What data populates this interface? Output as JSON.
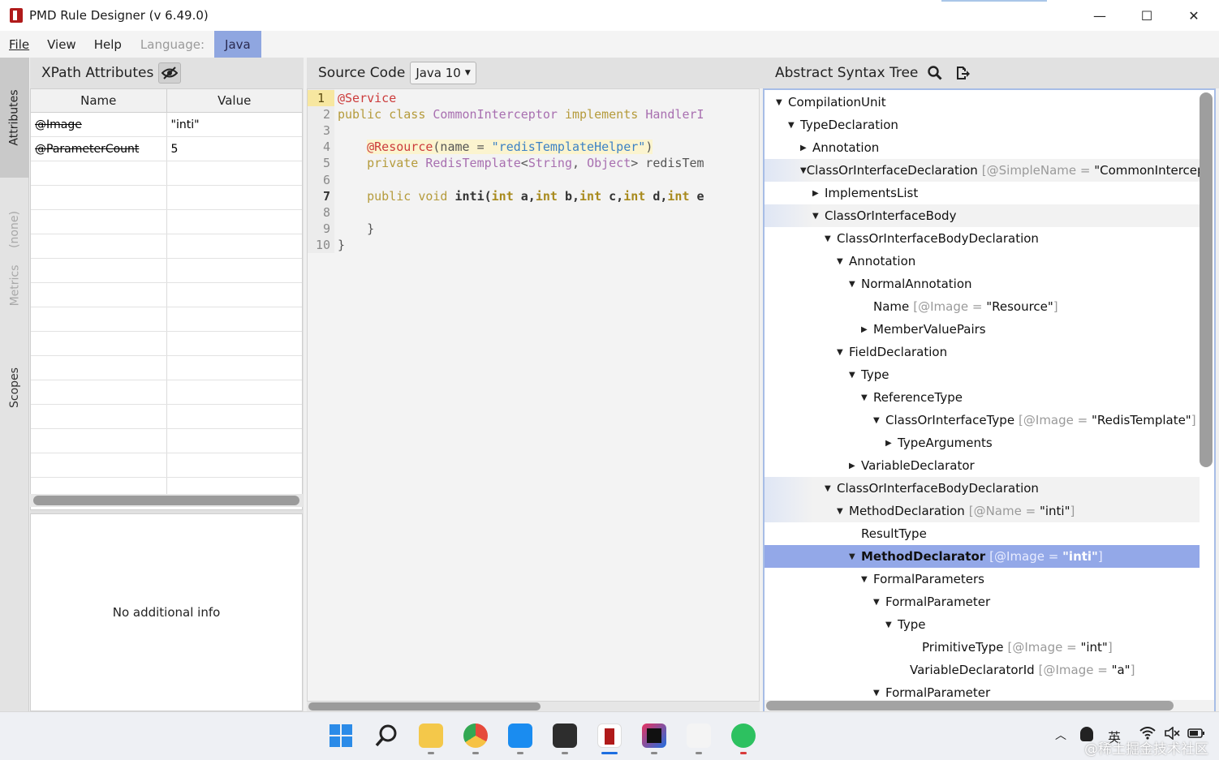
{
  "window": {
    "title": "PMD Rule Designer (v 6.49.0)",
    "minimize": "—",
    "maximize": "☐",
    "close": "✕"
  },
  "menu": {
    "file": "File",
    "view": "View",
    "help": "Help",
    "language_label": "Language:",
    "language_value": "Java"
  },
  "side_tabs": {
    "attributes": "Attributes",
    "none": "(none)",
    "metrics": "Metrics",
    "scopes": "Scopes"
  },
  "xpath_panel": {
    "title": "XPath Attributes",
    "col_name": "Name",
    "col_value": "Value",
    "rows": [
      {
        "name": "@Image",
        "value": "\"inti\""
      },
      {
        "name": "@ParameterCount",
        "value": "5"
      }
    ],
    "info": "No additional info"
  },
  "source_panel": {
    "title": "Source Code",
    "version": "Java 10",
    "current_line": 7,
    "lines": [
      {
        "n": "1",
        "segments": [
          {
            "t": "@Service",
            "c": "ann"
          }
        ]
      },
      {
        "n": "2",
        "segments": [
          {
            "t": "public class ",
            "c": "kw"
          },
          {
            "t": "CommonInterceptor ",
            "c": "cls"
          },
          {
            "t": "implements ",
            "c": "kw"
          },
          {
            "t": "HandlerI",
            "c": "cls"
          }
        ]
      },
      {
        "n": "3",
        "segments": []
      },
      {
        "n": "4",
        "segments": [
          {
            "t": "    ",
            "c": "plain"
          },
          {
            "t": "@Resource",
            "c": "ann"
          },
          {
            "t": "(name = ",
            "c": "plain"
          },
          {
            "t": "\"redisTemplateHelper\"",
            "c": "str"
          },
          {
            "t": ")",
            "c": "plain"
          }
        ]
      },
      {
        "n": "5",
        "segments": [
          {
            "t": "    private ",
            "c": "kw"
          },
          {
            "t": "RedisTemplate",
            "c": "cls"
          },
          {
            "t": "<",
            "c": "plain"
          },
          {
            "t": "String",
            "c": "cls"
          },
          {
            "t": ", ",
            "c": "plain"
          },
          {
            "t": "Object",
            "c": "cls"
          },
          {
            "t": "> redisTem",
            "c": "plain"
          }
        ]
      },
      {
        "n": "6",
        "segments": []
      },
      {
        "n": "7",
        "segments": [
          {
            "t": "    public void ",
            "c": "kw"
          },
          {
            "t": "inti(",
            "c": "bold"
          },
          {
            "t": "int ",
            "c": "kwb"
          },
          {
            "t": "a,",
            "c": "bold"
          },
          {
            "t": "int ",
            "c": "kwb"
          },
          {
            "t": "b,",
            "c": "bold"
          },
          {
            "t": "int ",
            "c": "kwb"
          },
          {
            "t": "c,",
            "c": "bold"
          },
          {
            "t": "int ",
            "c": "kwb"
          },
          {
            "t": "d,",
            "c": "bold"
          },
          {
            "t": "int ",
            "c": "kwb"
          },
          {
            "t": "e",
            "c": "bold"
          }
        ]
      },
      {
        "n": "8",
        "segments": []
      },
      {
        "n": "9",
        "segments": [
          {
            "t": "    }",
            "c": "plain"
          }
        ]
      },
      {
        "n": "10",
        "segments": [
          {
            "t": "}",
            "c": "plain"
          }
        ]
      }
    ]
  },
  "ast_panel": {
    "title": "Abstract Syntax Tree",
    "nodes": [
      {
        "label": "CompilationUnit",
        "depth": 0,
        "toggle": "open",
        "attr": "",
        "val": "",
        "style": ""
      },
      {
        "label": "TypeDeclaration",
        "depth": 1,
        "toggle": "open",
        "attr": "",
        "val": "",
        "style": ""
      },
      {
        "label": "Annotation",
        "depth": 2,
        "toggle": "closed",
        "attr": "",
        "val": "",
        "style": ""
      },
      {
        "label": "ClassOrInterfaceDeclaration",
        "depth": 2,
        "toggle": "open",
        "attr": "[@SimpleName = ",
        "val": "\"CommonIntercept",
        "style": "alt"
      },
      {
        "label": "ImplementsList",
        "depth": 3,
        "toggle": "closed",
        "attr": "",
        "val": "",
        "style": ""
      },
      {
        "label": "ClassOrInterfaceBody",
        "depth": 3,
        "toggle": "open",
        "attr": "",
        "val": "",
        "style": "alt"
      },
      {
        "label": "ClassOrInterfaceBodyDeclaration",
        "depth": 4,
        "toggle": "open",
        "attr": "",
        "val": "",
        "style": ""
      },
      {
        "label": "Annotation",
        "depth": 5,
        "toggle": "open",
        "attr": "",
        "val": "",
        "style": ""
      },
      {
        "label": "NormalAnnotation",
        "depth": 6,
        "toggle": "open",
        "attr": "",
        "val": "",
        "style": ""
      },
      {
        "label": "Name",
        "depth": 7,
        "toggle": "none",
        "attr": "[@Image = ",
        "val": "\"Resource\"",
        "style": ""
      },
      {
        "label": "MemberValuePairs",
        "depth": 7,
        "toggle": "closed",
        "attr": "",
        "val": "",
        "style": ""
      },
      {
        "label": "FieldDeclaration",
        "depth": 5,
        "toggle": "open",
        "attr": "",
        "val": "",
        "style": ""
      },
      {
        "label": "Type",
        "depth": 6,
        "toggle": "open",
        "attr": "",
        "val": "",
        "style": ""
      },
      {
        "label": "ReferenceType",
        "depth": 7,
        "toggle": "open",
        "attr": "",
        "val": "",
        "style": ""
      },
      {
        "label": "ClassOrInterfaceType",
        "depth": 8,
        "toggle": "open",
        "attr": "[@Image = ",
        "val": "\"RedisTemplate\"",
        "style": ""
      },
      {
        "label": "TypeArguments",
        "depth": 9,
        "toggle": "closed",
        "attr": "",
        "val": "",
        "style": ""
      },
      {
        "label": "VariableDeclarator",
        "depth": 6,
        "toggle": "closed",
        "attr": "",
        "val": "",
        "style": ""
      },
      {
        "label": "ClassOrInterfaceBodyDeclaration",
        "depth": 4,
        "toggle": "open",
        "attr": "",
        "val": "",
        "style": "alt"
      },
      {
        "label": "MethodDeclaration",
        "depth": 5,
        "toggle": "open",
        "attr": "[@Name = ",
        "val": "\"inti\"",
        "style": "alt"
      },
      {
        "label": "ResultType",
        "depth": 6,
        "toggle": "none",
        "attr": "",
        "val": "",
        "style": ""
      },
      {
        "label": "MethodDeclarator",
        "depth": 6,
        "toggle": "open",
        "attr": "[@Image = ",
        "val": "\"inti\"",
        "style": "sel"
      },
      {
        "label": "FormalParameters",
        "depth": 7,
        "toggle": "open",
        "attr": "",
        "val": "",
        "style": ""
      },
      {
        "label": "FormalParameter",
        "depth": 8,
        "toggle": "open",
        "attr": "",
        "val": "",
        "style": ""
      },
      {
        "label": "Type",
        "depth": 9,
        "toggle": "open",
        "attr": "",
        "val": "",
        "style": ""
      },
      {
        "label": "PrimitiveType",
        "depth": 11,
        "toggle": "none",
        "attr": "[@Image = ",
        "val": "\"int\"",
        "style": ""
      },
      {
        "label": "VariableDeclaratorId",
        "depth": 10,
        "toggle": "none",
        "attr": "[@Image = ",
        "val": "\"a\"",
        "style": ""
      },
      {
        "label": "FormalParameter",
        "depth": 8,
        "toggle": "open",
        "attr": "",
        "val": "",
        "style": ""
      }
    ]
  },
  "taskbar": {
    "tray_lang": "英",
    "watermark": "@稀土掘金技术社区"
  },
  "colors": {
    "language_highlight": "#8fa6e0",
    "selection": "#93a8e8",
    "current_line": "#f7e7a0"
  }
}
